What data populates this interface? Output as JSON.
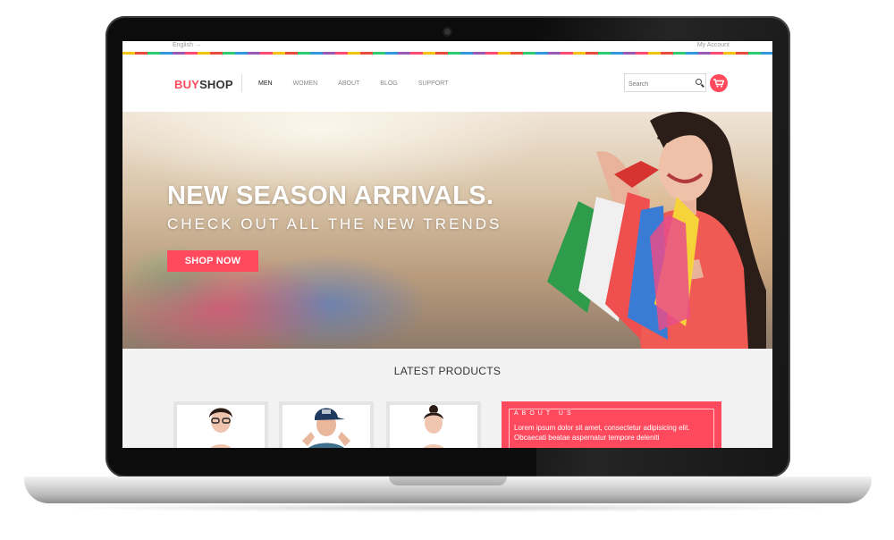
{
  "topbar": {
    "language": "English →",
    "account": "My Account"
  },
  "header": {
    "logo_part1": "BUY",
    "logo_part2": "SHOP",
    "nav": [
      "MEN",
      "WOMEN",
      "ABOUT",
      "BLOG",
      "SUPPORT"
    ],
    "search_placeholder": "Search"
  },
  "hero": {
    "title": "NEW SEASON ARRIVALS.",
    "subtitle": "CHECK OUT ALL THE NEW TRENDS",
    "button": "SHOP NOW"
  },
  "latest": {
    "title": "LATEST PRODUCTS",
    "about_title": "ABOUT US",
    "about_text": "Lorem ipsum dolor sit amet, consectetur adipisicing elit. Obcaecati beatae aspernatur tempore deleniti"
  },
  "colors": {
    "accent": "#ff4a5e",
    "text_dark": "#333333",
    "muted": "#888888"
  },
  "icons": [
    "search-icon",
    "cart-icon",
    "camera-icon"
  ]
}
